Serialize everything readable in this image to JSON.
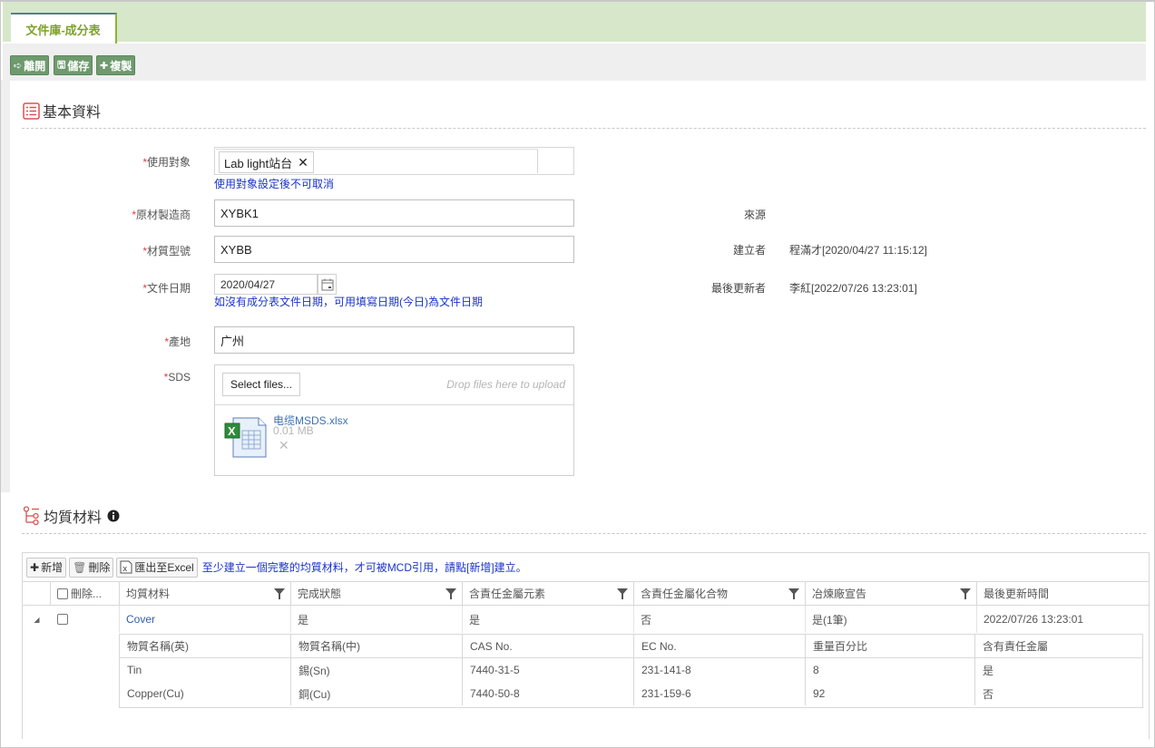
{
  "tab": {
    "label": "文件庫-成分表"
  },
  "toolbar": {
    "leave": "離開",
    "save": "儲存",
    "copy": "複製"
  },
  "basic": {
    "title": "基本資料",
    "target_label": "使用對象",
    "target_chip": "Lab light站台",
    "target_hint": "使用對象設定後不可取消",
    "maker_label": "原材製造商",
    "maker_value": "XYBK1",
    "model_label": "材質型號",
    "model_value": "XYBB",
    "date_label": "文件日期",
    "date_value": "2020/04/27",
    "date_hint": "如沒有成分表文件日期，可用填寫日期(今日)為文件日期",
    "origin_label": "產地",
    "origin_value": "广州",
    "sds_label": "SDS",
    "select_files": "Select files...",
    "drop_hint": "Drop files here to upload",
    "file_name": "电缆MSDS.xlsx",
    "file_size": "0.01 MB",
    "source_label": "來源",
    "source_value": "",
    "creator_label": "建立者",
    "creator_value": "程滿才[2020/04/27 11:15:12]",
    "updater_label": "最後更新者",
    "updater_value": "李紅[2022/07/26 13:23:01]"
  },
  "materials": {
    "title": "均質材料",
    "add": "新增",
    "delete": "刪除",
    "export": "匯出至Excel",
    "note": "至少建立一個完整的均質材料，才可被MCD引用，請點[新增]建立。",
    "headers": [
      "刪除...",
      "均質材料",
      "完成狀態",
      "含責任金屬元素",
      "含責任金屬化合物",
      "冶煉廠宣告",
      "最後更新時間"
    ],
    "rows": [
      {
        "name": "Cover",
        "status": "是",
        "element": "是",
        "compound": "否",
        "smelter": "是(1筆)",
        "updated": "2022/07/26 13:23:01",
        "detail_headers": [
          "物質名稱(英)",
          "物質名稱(中)",
          "CAS No.",
          "EC No.",
          "重量百分比",
          "含有責任金屬"
        ],
        "detail_rows": [
          [
            "Tin",
            "錫(Sn)",
            "7440-31-5",
            "231-141-8",
            "8",
            "是"
          ],
          [
            "Copper(Cu)",
            "銅(Cu)",
            "7440-50-8",
            "231-159-6",
            "92",
            "否"
          ]
        ]
      }
    ]
  }
}
